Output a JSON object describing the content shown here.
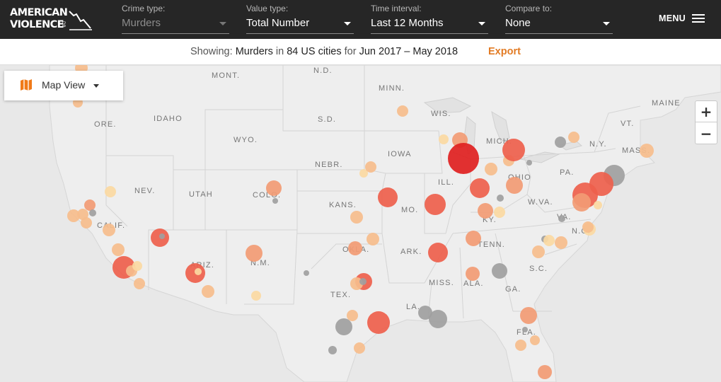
{
  "brand": {
    "line1": "AMERICAN",
    "line2": "VIOLENCE",
    "sub": "DB"
  },
  "filters": [
    {
      "label": "Crime type:",
      "value": "Murders",
      "disabled": true
    },
    {
      "label": "Value type:",
      "value": "Total Number",
      "disabled": false
    },
    {
      "label": "Time interval:",
      "value": "Last 12 Months",
      "disabled": false
    },
    {
      "label": "Compare to:",
      "value": "None",
      "disabled": false
    }
  ],
  "menu": {
    "label": "MENU"
  },
  "summary": {
    "prefix": "Showing:",
    "crime": "Murders",
    "in_word": "in",
    "cities": "84 US cities",
    "for_word": "for",
    "period": "Jun 2017 – May 2018",
    "export_label": "Export"
  },
  "map": {
    "view_label": "Map View",
    "zoom_in": "+",
    "zoom_out": "−",
    "state_labels": [
      "MONT.",
      "N.D.",
      "MINN.",
      "MAINE",
      "ORE.",
      "IDAHO",
      "S.D.",
      "WIS.",
      "MICH.",
      "VT.",
      "WYO.",
      "IOWA",
      "N.Y.",
      "MASS.",
      "NEBR.",
      "PA.",
      "NEV.",
      "UTAH",
      "COLO.",
      "ILL.",
      "OHIO",
      "KANS.",
      "MO.",
      "W.VA.",
      "VA.",
      "CALIF.",
      "KY.",
      "N.C.",
      "OKLA.",
      "TENN.",
      "ARK.",
      "ARIZ.",
      "N.M.",
      "S.C.",
      "MISS.",
      "ALA.",
      "GA.",
      "TEX.",
      "LA.",
      "FLA."
    ],
    "colors": {
      "very_high": "#e02020",
      "high": "#ee5f4c",
      "medium": "#f29b74",
      "low": "#f6bd8c",
      "very_low": "#fbd9a2",
      "no_data": "#a0a0a0"
    }
  }
}
